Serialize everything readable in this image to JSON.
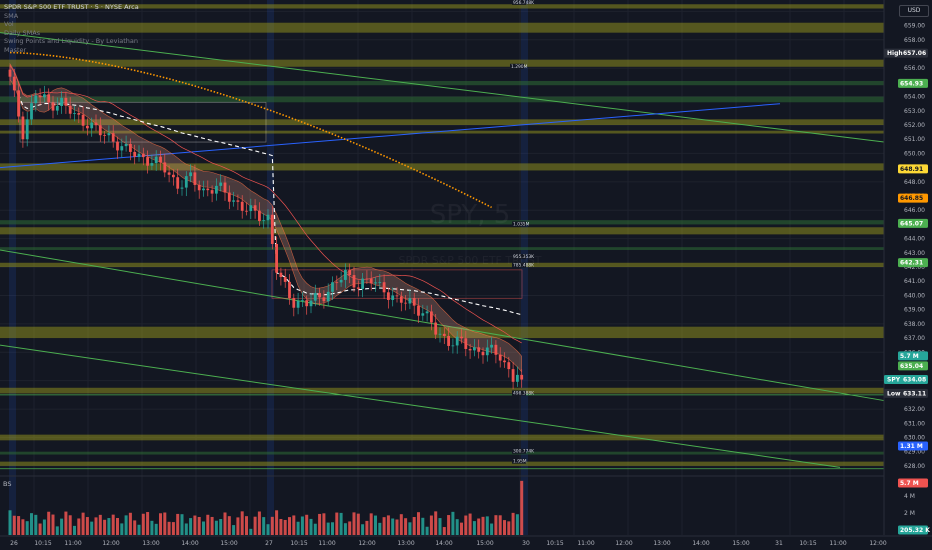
{
  "legend": {
    "title": "SPDR S&P 500 ETF TRUST · 5 · NYSE Arca",
    "lines": [
      "SMA",
      "Vol",
      "Daily SMAs",
      "Swing Points and Liquidity - By Leviathan",
      "Master"
    ]
  },
  "watermark": {
    "symbol": "SPY, 5",
    "name": "SPDR S&P 500 ETF TRUST"
  },
  "currency_button": "USD",
  "volume_pane": {
    "label": "BS"
  },
  "price_axis": {
    "ticks": [
      "660.00",
      "659.00",
      "658.00",
      "657.00",
      "656.00",
      "655.00",
      "654.00",
      "653.00",
      "652.00",
      "651.00",
      "650.00",
      "649.00",
      "648.00",
      "647.00",
      "646.00",
      "645.00",
      "644.00",
      "643.00",
      "642.00",
      "641.00",
      "640.00",
      "639.00",
      "638.00",
      "637.00",
      "636.00",
      "635.00",
      "634.00",
      "633.00",
      "632.00",
      "631.00",
      "630.00",
      "629.00",
      "628.00"
    ]
  },
  "volume_axis": {
    "ticks": [
      "4 M",
      "2 M"
    ]
  },
  "time_axis": {
    "labels": [
      "26",
      "10:15",
      "11:00",
      "12:00",
      "13:00",
      "14:00",
      "15:00",
      "27",
      "10:15",
      "11:00",
      "12:00",
      "13:00",
      "14:00",
      "15:00",
      "30",
      "10:15",
      "11:00",
      "12:00",
      "13:00",
      "14:00",
      "15:00",
      "31",
      "10:15",
      "11:00",
      "12:00"
    ]
  },
  "price_tags": [
    {
      "label": "High",
      "value": "657.06",
      "color": "#2a2e39",
      "text": "#ffffff"
    },
    {
      "value": "654.93",
      "color": "#4caf50",
      "text": "#ffffff"
    },
    {
      "value": "648.91",
      "color": "#fdd835",
      "text": "#131722"
    },
    {
      "value": "646.85",
      "color": "#ff9800",
      "text": "#131722"
    },
    {
      "value": "645.07",
      "color": "#4caf50",
      "text": "#ffffff"
    },
    {
      "value": "642.31",
      "color": "#4caf50",
      "text": "#ffffff"
    },
    {
      "value": "5.7 M",
      "color": "#26a69a",
      "text": "#ffffff"
    },
    {
      "value": "635.04",
      "color": "#4caf50",
      "text": "#ffffff"
    },
    {
      "label": "SPY",
      "value": "634.08",
      "color": "#26a69a",
      "text": "#ffffff"
    },
    {
      "label": "Low",
      "value": "633.11",
      "color": "#2a2e39",
      "text": "#ffffff"
    },
    {
      "value": "1.31 M",
      "color": "#2962ff",
      "text": "#ffffff"
    },
    {
      "value": "5.7 M",
      "color": "#ef5350",
      "text": "#ffffff"
    },
    {
      "value": "205.32 K",
      "color": "#26a69a",
      "text": "#ffffff"
    }
  ],
  "level_labels": [
    "956.748K",
    "1.290M",
    "1.035M",
    "955.353K",
    "785.488K",
    "498.388K",
    "300.774K",
    "1.95M"
  ],
  "colors": {
    "background": "#131722",
    "up": "#26a69a",
    "down": "#ef5350",
    "zone_yellow": "#8c8c1e",
    "zone_green": "#2e6b35",
    "trend_green": "#4caf50",
    "trend_blue": "#2962ff",
    "sma_orange": "#ff9800",
    "vwap": "#ffffff",
    "ribbon": "#f0a58c"
  },
  "chart_data": {
    "type": "candlestick",
    "symbol": "SPY",
    "interval": "5",
    "ylim": [
      627.5,
      660.8
    ],
    "high": 657.06,
    "low": 633.11,
    "last": 634.08,
    "sessions": [
      "26",
      "27",
      "30"
    ],
    "close_path": [
      [
        0,
        655.2
      ],
      [
        3,
        651.5
      ],
      [
        6,
        654.2
      ],
      [
        9,
        653.5
      ],
      [
        12,
        653.6
      ],
      [
        15,
        652.6
      ],
      [
        18,
        652.2
      ],
      [
        21,
        651.4
      ],
      [
        24,
        651.0
      ],
      [
        27,
        650.2
      ],
      [
        30,
        649.8
      ],
      [
        33,
        649.5
      ],
      [
        36,
        648.9
      ],
      [
        39,
        647.8
      ],
      [
        42,
        648.2
      ],
      [
        45,
        647.4
      ],
      [
        48,
        647.6
      ],
      [
        51,
        647.0
      ],
      [
        54,
        646.2
      ],
      [
        57,
        645.7
      ],
      [
        60,
        645.5
      ],
      [
        62,
        641.8
      ],
      [
        63,
        641.0
      ],
      [
        66,
        639.6
      ],
      [
        69,
        639.4
      ],
      [
        72,
        639.9
      ],
      [
        75,
        640.6
      ],
      [
        78,
        641.5
      ],
      [
        81,
        640.8
      ],
      [
        84,
        641.0
      ],
      [
        87,
        640.5
      ],
      [
        90,
        639.5
      ],
      [
        93,
        639.6
      ],
      [
        96,
        638.8
      ],
      [
        99,
        637.5
      ],
      [
        102,
        636.8
      ],
      [
        105,
        636.6
      ],
      [
        108,
        636.2
      ],
      [
        111,
        636.1
      ],
      [
        114,
        635.8
      ],
      [
        117,
        634.2
      ],
      [
        119,
        634.6
      ]
    ],
    "horizontal_zones": [
      {
        "y0": 660.5,
        "y1": 660.2,
        "color": "yellow"
      },
      {
        "y0": 659.2,
        "y1": 658.5,
        "color": "yellow"
      },
      {
        "y0": 656.6,
        "y1": 656.1,
        "color": "yellow"
      },
      {
        "y0": 655.1,
        "y1": 654.8,
        "color": "green"
      },
      {
        "y0": 654.0,
        "y1": 653.6,
        "color": "green"
      },
      {
        "y0": 652.4,
        "y1": 652.0,
        "color": "yellow"
      },
      {
        "y0": 651.6,
        "y1": 651.4,
        "color": "yellow"
      },
      {
        "y0": 649.3,
        "y1": 648.8,
        "color": "yellow"
      },
      {
        "y0": 645.3,
        "y1": 645.0,
        "color": "green"
      },
      {
        "y0": 644.8,
        "y1": 644.3,
        "color": "yellow"
      },
      {
        "y0": 643.4,
        "y1": 643.2,
        "color": "green"
      },
      {
        "y0": 642.3,
        "y1": 642.0,
        "color": "yellow"
      },
      {
        "y0": 637.8,
        "y1": 637.0,
        "color": "yellow"
      },
      {
        "y0": 633.5,
        "y1": 633.1,
        "color": "yellow"
      },
      {
        "y0": 630.2,
        "y1": 629.8,
        "color": "yellow"
      },
      {
        "y0": 629.0,
        "y1": 628.8,
        "color": "green"
      },
      {
        "y0": 628.3,
        "y1": 628.0,
        "color": "yellow"
      }
    ],
    "volume_max": 5.7,
    "volume_unit": "M",
    "grid": true
  }
}
